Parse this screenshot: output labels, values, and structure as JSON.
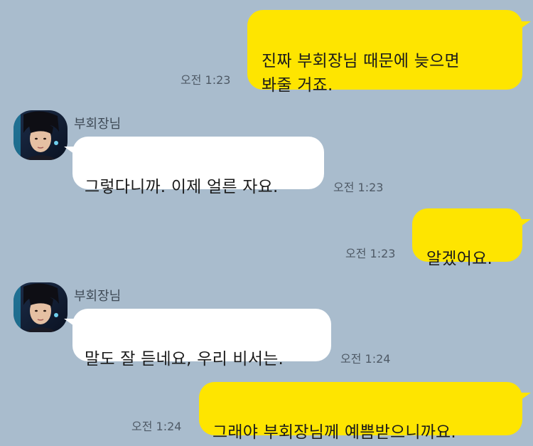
{
  "sender_name": "부회장님",
  "colors": {
    "background": "#a9bccd",
    "my_bubble": "#fee500",
    "their_bubble": "#ffffff",
    "time_text": "#4f5a66"
  },
  "messages": [
    {
      "from": "me",
      "text": "진짜 부회장님 때문에 늦으면\n봐줄 거죠.",
      "time": "오전 1:23"
    },
    {
      "from": "them",
      "sender": "부회장님",
      "text": "그렇다니까. 이제 얼른 자요.",
      "time": "오전 1:23"
    },
    {
      "from": "me",
      "text": "알겠어요.",
      "time": "오전 1:23"
    },
    {
      "from": "them",
      "sender": "부회장님",
      "text": "말도 잘 듣네요, 우리 비서는.",
      "time": "오전 1:24"
    },
    {
      "from": "me",
      "text": "그래야 부회장님께 예쁨받으니까요.",
      "time": "오전 1:24"
    }
  ]
}
